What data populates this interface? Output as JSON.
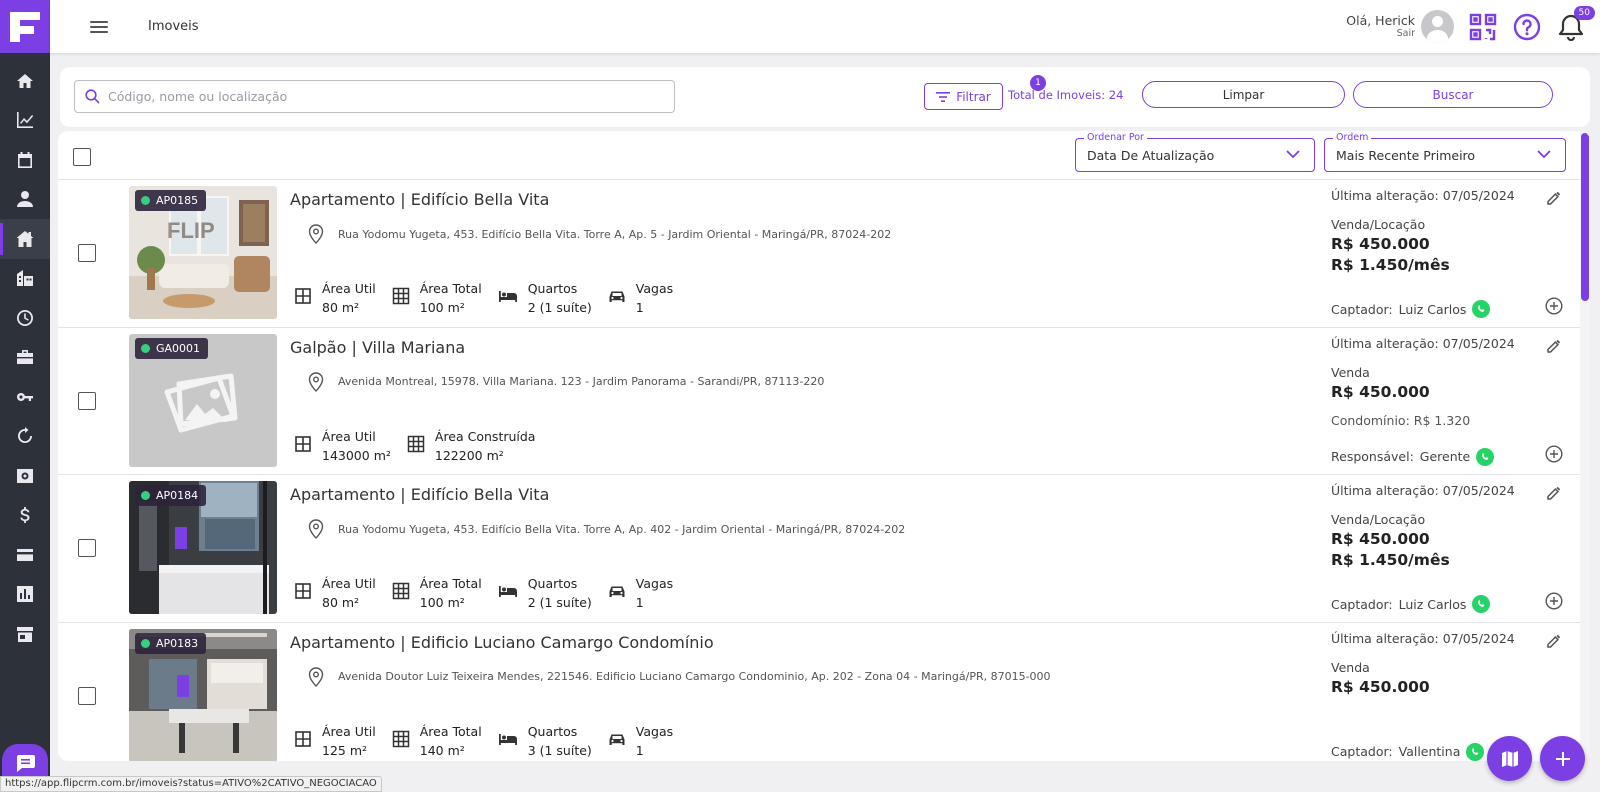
{
  "app": {
    "page_title": "Imoveis",
    "greeting": "Olá, Herick",
    "logout": "Sair",
    "notification_count": "50",
    "accent_color": "#7b3fe4"
  },
  "sidebar": {
    "icons": [
      "home-icon",
      "chart-icon",
      "calendar-icon",
      "person-icon",
      "house-icon",
      "building-icon",
      "clock-icon",
      "briefcase-icon",
      "key-icon",
      "refresh-icon",
      "safe-icon",
      "dollar-icon",
      "card-icon",
      "report-icon",
      "store-icon"
    ],
    "active": "house-icon"
  },
  "search": {
    "placeholder": "Código, nome ou localização",
    "filter_label": "Filtrar",
    "filter_badge": "1",
    "total": "Total de Imoveis: 24",
    "clear_label": "Limpar",
    "search_label": "Buscar"
  },
  "sort": {
    "order_by_label": "Ordenar Por",
    "order_by_value": "Data De Atualização",
    "order_label": "Ordem",
    "order_value": "Mais Recente Primeiro"
  },
  "listings": [
    {
      "code": "AP0185",
      "title": "Apartamento | Edifício Bella Vita",
      "address": "Rua Yodomu Yugeta, 453. Edifício Bella Vita. Torre A, Ap. 5 - Jardim Oriental - Maringá/PR, 87024-202",
      "specs": [
        {
          "label": "Área Util",
          "value": "80 m²",
          "icon": "area-icon"
        },
        {
          "label": "Área Total",
          "value": "100 m²",
          "icon": "grid-icon"
        },
        {
          "label": "Quartos",
          "value": "2 (1 suíte)",
          "icon": "bed-icon"
        },
        {
          "label": "Vagas",
          "value": "1",
          "icon": "car-icon"
        }
      ],
      "last_update": "Última alteração: 07/05/2024",
      "transaction": "Venda/Locação",
      "price": "R$ 450.000",
      "secondary": "R$ 1.450/mês",
      "condo": "",
      "agent_role": "Captador:",
      "agent_name": "Luiz Carlos",
      "image": "living-room"
    },
    {
      "code": "GA0001",
      "title": "Galpão | Villa Mariana",
      "address": "Avenida Montreal, 15978. Villa Mariana. 123 - Jardim Panorama - Sarandi/PR, 87113-220",
      "specs": [
        {
          "label": "Área Util",
          "value": "143000 m²",
          "icon": "area-icon"
        },
        {
          "label": "Área Construída",
          "value": "122200 m²",
          "icon": "grid-icon"
        }
      ],
      "last_update": "Última alteração: 07/05/2024",
      "transaction": "Venda",
      "price": "R$ 450.000",
      "secondary": "",
      "condo": "Condomínio: R$ 1.320",
      "agent_role": "Responsável:",
      "agent_name": "Gerente",
      "image": "placeholder"
    },
    {
      "code": "AP0184",
      "title": "Apartamento | Edifício Bella Vita",
      "address": "Rua Yodomu Yugeta, 453. Edifício Bella Vita. Torre A, Ap. 402 - Jardim Oriental - Maringá/PR, 87024-202",
      "specs": [
        {
          "label": "Área Util",
          "value": "80 m²",
          "icon": "area-icon"
        },
        {
          "label": "Área Total",
          "value": "100 m²",
          "icon": "grid-icon"
        },
        {
          "label": "Quartos",
          "value": "2 (1 suíte)",
          "icon": "bed-icon"
        },
        {
          "label": "Vagas",
          "value": "1",
          "icon": "car-icon"
        }
      ],
      "last_update": "Última alteração: 07/05/2024",
      "transaction": "Venda/Locação",
      "price": "R$ 450.000",
      "secondary": "R$ 1.450/mês",
      "condo": "",
      "agent_role": "Captador:",
      "agent_name": "Luiz Carlos",
      "image": "bathroom"
    },
    {
      "code": "AP0183",
      "title": "Apartamento | Edificio Luciano Camargo Condomínio",
      "address": "Avenida Doutor Luiz Teixeira Mendes, 221546. Edificio Luciano Camargo Condominio, Ap. 202 - Zona 04 - Maringá/PR, 87015-000",
      "specs": [
        {
          "label": "Área Util",
          "value": "125 m²",
          "icon": "area-icon"
        },
        {
          "label": "Área Total",
          "value": "140 m²",
          "icon": "grid-icon"
        },
        {
          "label": "Quartos",
          "value": "3 (1 suíte)",
          "icon": "bed-icon"
        },
        {
          "label": "Vagas",
          "value": "1",
          "icon": "car-icon"
        }
      ],
      "last_update": "Última alteração: 07/05/2024",
      "transaction": "Venda",
      "price": "R$ 450.000",
      "secondary": "",
      "condo": "",
      "agent_role": "Captador:",
      "agent_name": "Vallentina",
      "image": "kitchen"
    }
  ],
  "status_url": "https://app.flipcrm.com.br/imoveis?status=ATIVO%2CATIVO_NEGOCIACAO"
}
